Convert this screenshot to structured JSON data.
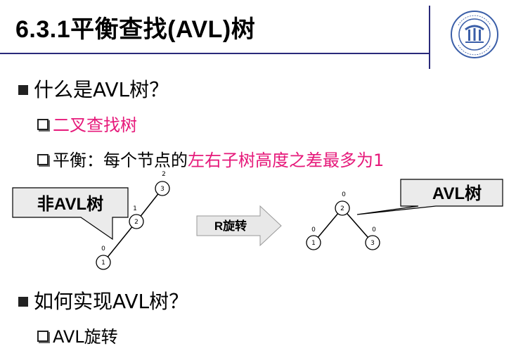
{
  "slide": {
    "title": "6.3.1平衡查找(AVL)树",
    "logo_icon": "university-seal-icon"
  },
  "section1": {
    "question": "什么是AVL树？",
    "sub1": "二叉查找树",
    "sub2_prefix": "平衡：每个节点的",
    "sub2_highlight": "左右子树高度之差最多为1"
  },
  "diagram": {
    "left_callout": "非AVL树",
    "arrow_label": "R旋转",
    "right_callout": "AVL树",
    "left_tree": [
      {
        "key": "3",
        "height_label": "2"
      },
      {
        "key": "2",
        "height_label": "1"
      },
      {
        "key": "1",
        "height_label": "0"
      }
    ],
    "right_tree": [
      {
        "key": "2",
        "height_label": "0"
      },
      {
        "key": "1",
        "height_label": "0"
      },
      {
        "key": "3",
        "height_label": "0"
      }
    ]
  },
  "section2": {
    "question": "如何实现AVL树？",
    "sub1": "AVL旋转"
  },
  "colors": {
    "highlight": "#e6197a",
    "callout_fill": "#ebebeb",
    "arrow_fill": "#e8e8e8",
    "rule": "#2a2a7a"
  }
}
